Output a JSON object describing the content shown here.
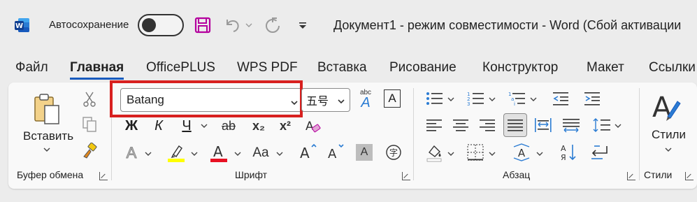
{
  "titlebar": {
    "autosave_label": "Автосохранение",
    "document_title": "Документ1  -  режим совместимости  -  Word (Сбой активации"
  },
  "tabs": [
    {
      "label": "Файл"
    },
    {
      "label": "Главная"
    },
    {
      "label": "OfficePLUS"
    },
    {
      "label": "WPS PDF"
    },
    {
      "label": "Вставка"
    },
    {
      "label": "Рисование"
    },
    {
      "label": "Конструктор"
    },
    {
      "label": "Макет"
    },
    {
      "label": "Ссылки"
    }
  ],
  "clipboard": {
    "paste_label": "Вставить",
    "group_label": "Буфер обмена"
  },
  "font": {
    "font_name": "Batang",
    "font_size": "五号",
    "bold": "Ж",
    "italic": "К",
    "underline": "Ч",
    "strikethrough": "ab",
    "subscript": "x₂",
    "superscript": "x²",
    "case_label": "Aa",
    "phonetic_label": "abc",
    "group_label": "Шрифт",
    "highlight_color": "#ffff00",
    "font_color": "#e81123"
  },
  "paragraph": {
    "group_label": "Абзац"
  },
  "styles": {
    "label": "Стили",
    "group_label": "Стили"
  },
  "colors": {
    "accent": "#185abd",
    "focus_box": "#d8201f"
  }
}
